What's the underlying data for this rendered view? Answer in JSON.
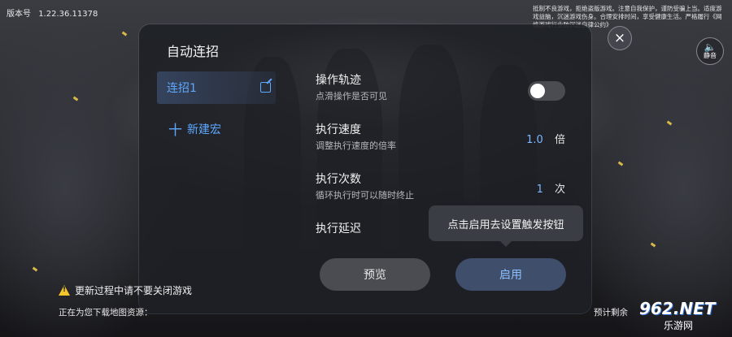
{
  "top_bar": {
    "version_label": "版本号",
    "version": "1.22.36.11378"
  },
  "notice": "抵制不良游戏，拒绝盗版游戏。注意自我保护，谨防受骗上当。适度游戏益脑，沉迷游戏伤身。合理安排时间，享受健康生活。严格履行《网络游戏行业防沉迷自律公约》",
  "close_label": "×",
  "mute": {
    "icon": "speaker-icon",
    "label": "静音"
  },
  "panel": {
    "title": "自动连招",
    "macros": [
      {
        "name": "连招1"
      }
    ],
    "new_macro_plus": "十",
    "new_macro_label": "新建宏",
    "settings": {
      "trajectory": {
        "title": "操作轨迹",
        "desc": "点滑操作是否可见",
        "toggle_on": false
      },
      "speed": {
        "title": "执行速度",
        "desc": "调整执行速度的倍率",
        "value": "1.0",
        "unit": "倍"
      },
      "count": {
        "title": "执行次数",
        "desc": "循环执行时可以随时终止",
        "value": "1",
        "unit": "次"
      },
      "delay": {
        "title": "执行延迟"
      }
    },
    "tooltip": "点击启用去设置触发按钮",
    "preview_label": "预览",
    "enable_label": "启用"
  },
  "footer": {
    "update_warning": "更新过程中请不要关闭游戏",
    "download_text": "正在为您下载地图资源：",
    "eta_text": "预计剩余"
  },
  "watermark": {
    "brand": "962.NET",
    "sub": "乐游网"
  },
  "colors": {
    "accent": "#5ea8ff",
    "warning": "#f3c52a"
  }
}
